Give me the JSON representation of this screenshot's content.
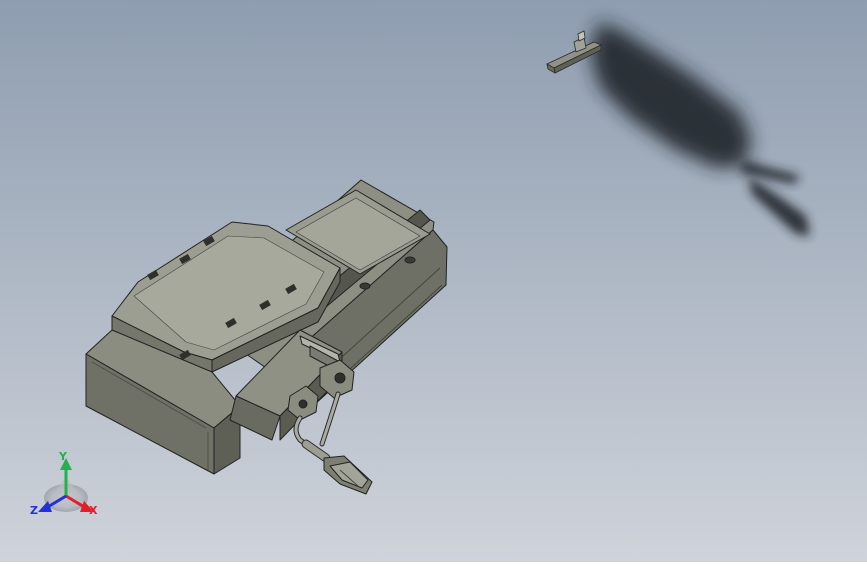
{
  "viewport": {
    "background_top": "#8e9db0",
    "background_bottom": "#cfd3da"
  },
  "model": {
    "body_color": "#7d7f72",
    "shadow_color": "#1e2126"
  },
  "triad": {
    "x_label": "X",
    "y_label": "Y",
    "z_label": "Z",
    "x_color": "#e0202a",
    "y_color": "#22b14c",
    "z_color": "#2430d8"
  }
}
